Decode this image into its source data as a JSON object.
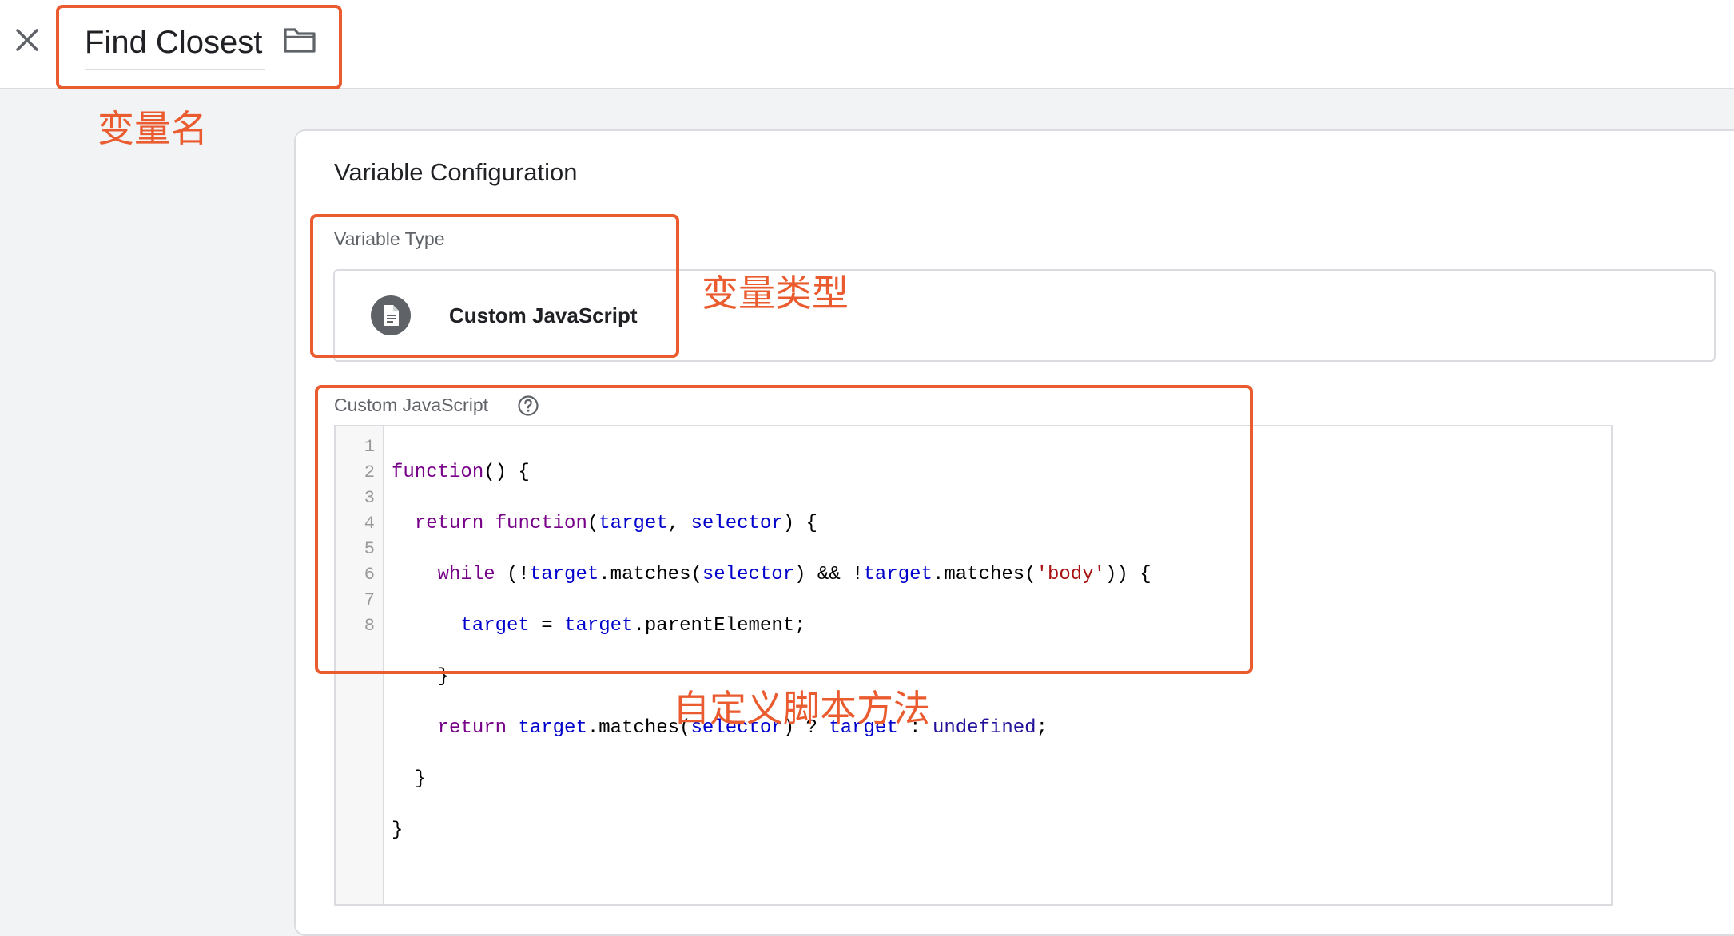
{
  "header": {
    "variable_name": "Find Closest"
  },
  "config": {
    "section_title": "Variable Configuration",
    "type_label": "Variable Type",
    "type_value": "Custom JavaScript",
    "code_label": "Custom JavaScript"
  },
  "editor": {
    "line_numbers": [
      "1",
      "2",
      "3",
      "4",
      "5",
      "6",
      "7",
      "8"
    ]
  },
  "annotations": {
    "name": "变量名",
    "type": "变量类型",
    "code": "自定义脚本方法"
  },
  "colors": {
    "annotation": "#ea5b2f"
  }
}
